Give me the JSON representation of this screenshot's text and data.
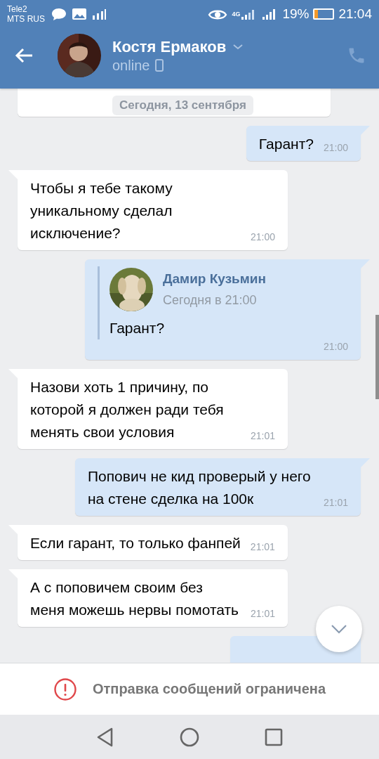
{
  "status_bar": {
    "carriers": [
      "Tele2",
      "MTS RUS"
    ],
    "network": "4G",
    "battery": "19%",
    "time": "21:04"
  },
  "header": {
    "name": "Костя Ермаков",
    "status": "online"
  },
  "date_divider": "Сегодня, 13 сентября",
  "messages": [
    {
      "kind": "partial",
      "outgoing": false
    },
    {
      "kind": "text",
      "outgoing": true,
      "text": "Гарант?",
      "time": "21:00"
    },
    {
      "kind": "text",
      "outgoing": false,
      "text": "Чтобы я тебе такому уникальному сделал исключение?",
      "time": "21:00"
    },
    {
      "kind": "forward",
      "outgoing": true,
      "forward": {
        "author": "Дамир Кузьмин",
        "date": "Сегодня в 21:00",
        "text": "Гарант?"
      },
      "time": "21:00"
    },
    {
      "kind": "text",
      "outgoing": false,
      "text": "Назови хоть 1 причину, по которой я должен ради тебя менять свои условия",
      "time": "21:01"
    },
    {
      "kind": "text",
      "outgoing": true,
      "text": "Попович не кид проверый у него на стене сделка на 100к",
      "time": "21:01"
    },
    {
      "kind": "text",
      "outgoing": false,
      "text": "Если гарант, то только фанпей",
      "time": "21:01"
    },
    {
      "kind": "text",
      "outgoing": false,
      "text": "А с поповичем своим без меня можешь нервы помотать",
      "time": "21:01"
    },
    {
      "kind": "partial",
      "outgoing": true
    }
  ],
  "notice": "Отправка сообщений ограничена"
}
